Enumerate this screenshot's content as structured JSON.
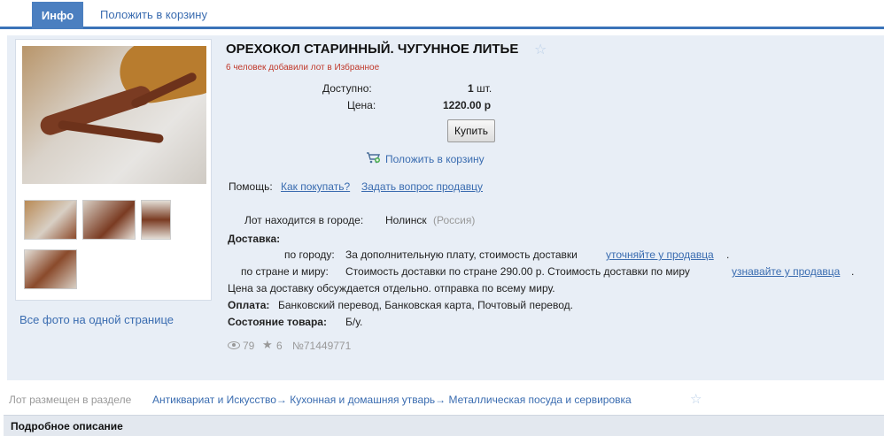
{
  "tabs": {
    "active": "Инфо",
    "add_to_cart": "Положить в корзину"
  },
  "lot": {
    "title": "ОРЕХОКОЛ СТАРИННЫЙ. ЧУГУННОЕ ЛИТЬЕ",
    "favorites_note": "6 человек добавили лот в Избранное",
    "available_label": "Доступно:",
    "available_qty": "1",
    "available_unit": "шт.",
    "price_label": "Цена:",
    "price_value": "1220.00 р",
    "buy_button": "Купить",
    "cart_link": "Положить в корзину"
  },
  "help": {
    "label": "Помощь:",
    "how_to_buy": "Как покупать?",
    "ask_seller": "Задать вопрос продавцу"
  },
  "location": {
    "label": "Лот находится в городе:",
    "city": "Нолинск",
    "country": "(Россия)"
  },
  "delivery": {
    "label": "Доставка:",
    "city_label": "по городу:",
    "city_text": "За дополнительную плату, стоимость доставки",
    "city_link": "уточняйте у продавца",
    "world_label": "по стране и миру:",
    "world_text": "Стоимость доставки по стране 290.00 р. Стоимость доставки по миру",
    "world_link": "узнавайте у продавца",
    "note": "Цена за доставку обсуждается отдельно. отправка по всему миру.",
    "dot": "."
  },
  "payment": {
    "label": "Оплата:",
    "value": "Банковский перевод, Банковская карта, Почтовый перевод."
  },
  "condition": {
    "label": "Состояние товара:",
    "value": "Б/у."
  },
  "stats": {
    "views": "79",
    "favorites": "6",
    "lot_number": "№71449771"
  },
  "gallery": {
    "all_photos": "Все фото на одной странице"
  },
  "category": {
    "label": "Лот размещен в разделе",
    "path": "Антиквариат и Искусство→ Кухонная и домашняя утварь→ Металлическая посуда и сервировка"
  },
  "description": {
    "title": "Подробное описание"
  }
}
